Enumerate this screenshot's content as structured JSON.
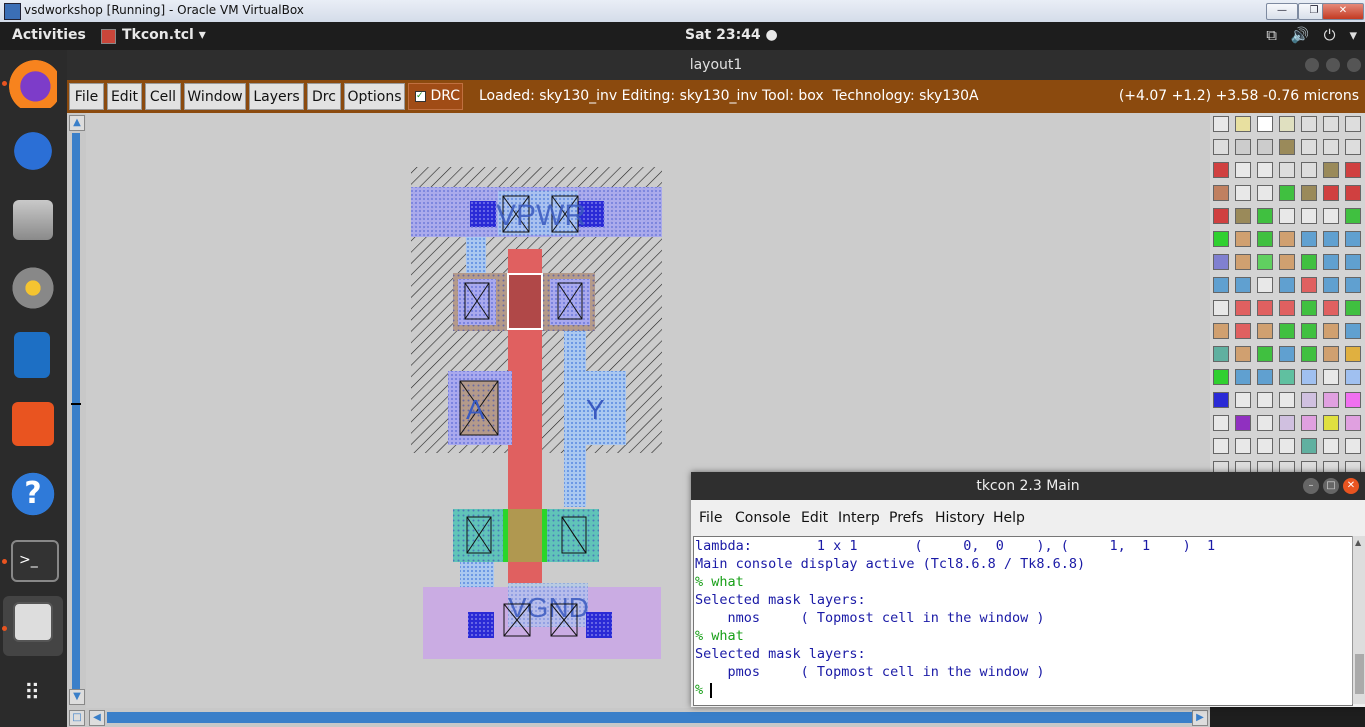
{
  "host_window": {
    "title": "vsdworkshop [Running] - Oracle VM VirtualBox"
  },
  "top_panel": {
    "activities": "Activities",
    "app_name": "Tkcon.tcl ▾",
    "clock": "Sat 23:44 ●"
  },
  "layout_window": {
    "title": "layout1",
    "menu": [
      "File",
      "Edit",
      "Cell",
      "Window",
      "Layers",
      "Drc",
      "Options"
    ],
    "drc_label": "DRC",
    "status": "Loaded: sky130_inv Editing: sky130_inv Tool: box  Technology: sky130A",
    "coords": "(+4.07 +1.2) +3.58 -0.76 microns",
    "layout_labels": {
      "vpwr": "VPWR",
      "vgnd": "VGND",
      "a": "A",
      "y": "Y"
    }
  },
  "tkcon": {
    "title": "tkcon 2.3 Main",
    "menu": [
      "File",
      "Console",
      "Edit",
      "Interp",
      "Prefs",
      "History",
      "Help"
    ],
    "lines": [
      {
        "text": "lambda:        1 x 1       (     0,  0    ), (     1,  1    )  1",
        "prompt": false
      },
      {
        "text": "Main console display active (Tcl8.6.8 / Tk8.6.8)",
        "prompt": false
      },
      {
        "text": "% what",
        "prompt": true
      },
      {
        "text": "Selected mask layers:",
        "prompt": false
      },
      {
        "text": "    nmos     ( Topmost cell in the window )",
        "prompt": false
      },
      {
        "text": "% what",
        "prompt": true
      },
      {
        "text": "Selected mask layers:",
        "prompt": false
      },
      {
        "text": "    pmos     ( Topmost cell in the window )",
        "prompt": false
      },
      {
        "text": "% ",
        "prompt": true
      }
    ]
  },
  "colors": {
    "accent": "#e95420",
    "menubar": "#8b4a0e",
    "console_text": "#1a1aa6",
    "prompt": "#18a018"
  }
}
